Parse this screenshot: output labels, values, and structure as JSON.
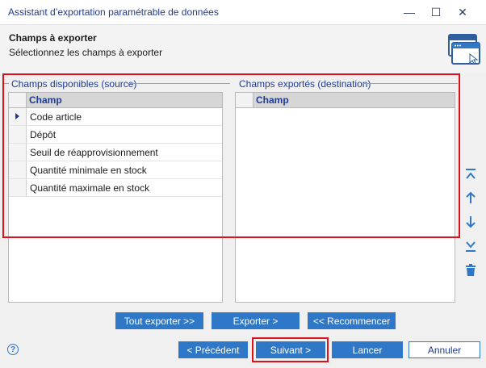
{
  "window": {
    "title": "Assistant d’exportation paramétrable de données",
    "controls": {
      "minimize": "—",
      "maximize": "☐",
      "close": "✕"
    }
  },
  "header": {
    "title": "Champs à exporter",
    "subtitle": "Sélectionnez les champs à exporter",
    "icon": "wizard-window-icon"
  },
  "source": {
    "group_label": "Champs disponibles (source)",
    "column": "Champ",
    "rows": [
      "Code article",
      "Dépôt",
      "Seuil de réapprovisionnement",
      "Quantité minimale en stock",
      "Quantité maximale en stock"
    ],
    "current_row_index": 0
  },
  "destination": {
    "group_label": "Champs exportés (destination)",
    "column": "Champ",
    "rows": []
  },
  "side_toolbar": [
    "move-to-top-icon",
    "move-up-icon",
    "move-down-icon",
    "move-to-bottom-icon",
    "trash-icon"
  ],
  "actions": {
    "export_all": "Tout exporter >>",
    "export": "Exporter >",
    "restart": "<< Recommencer"
  },
  "footer": {
    "help": "?",
    "previous": "< Précédent",
    "next": "Suivant >",
    "launch": "Lancer",
    "cancel": "Annuler"
  },
  "colors": {
    "accent": "#2f78c8",
    "title_text": "#1f3a93",
    "highlight": "#e0101a"
  }
}
